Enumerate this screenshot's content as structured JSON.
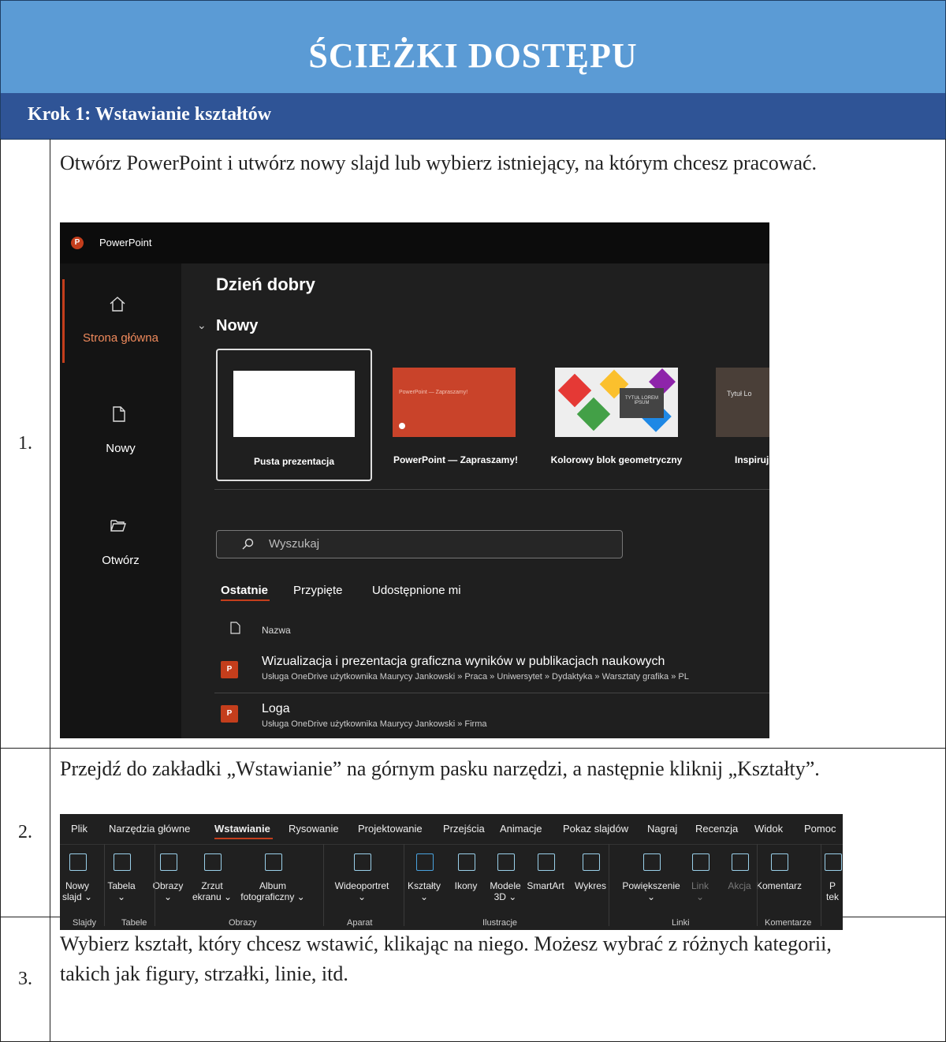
{
  "header": {
    "title": "ŚCIEŻKI DOSTĘPU"
  },
  "step": {
    "title": "Krok 1: Wstawianie kształtów"
  },
  "rows": [
    {
      "num": "1.",
      "text": "Otwórz PowerPoint i utwórz nowy slajd lub wybierz istniejący, na którym chcesz pracować."
    },
    {
      "num": "2.",
      "text": "Przejdź do zakładki „Wstawianie” na górnym pasku narzędzi, a następnie kliknij „Kształty”."
    },
    {
      "num": "3.",
      "text": "Wybierz kształt, który chcesz wstawić, klikając na niego. Możesz wybrać z różnych kategorii, takich jak figury, strzałki, linie, itd."
    }
  ],
  "ppt": {
    "app_name": "PowerPoint",
    "nav": {
      "home": "Strona główna",
      "new": "Nowy",
      "open": "Otwórz"
    },
    "greeting": "Dzień dobry",
    "new_section": "Nowy",
    "templates": [
      {
        "label": "Pusta prezentacja"
      },
      {
        "label": "PowerPoint — Zapraszamy!",
        "thumb_text": "PowerPoint — Zapraszamy!"
      },
      {
        "label": "Kolorowy blok geometryczny",
        "thumb_text": "TYTUŁ LOREM IPSUM"
      },
      {
        "label": "Inspiruj",
        "thumb_text": "Tytuł Lo"
      }
    ],
    "search_placeholder": "Wyszukaj",
    "tabs": [
      "Ostatnie",
      "Przypięte",
      "Udostępnione mi"
    ],
    "column_name": "Nazwa",
    "files": [
      {
        "name": "Wizualizacja i prezentacja graficzna wyników w publikacjach naukowych",
        "path": "Usługa OneDrive użytkownika Maurycy Jankowski » Praca » Uniwersytet » Dydaktyka » Warsztaty grafika » PL"
      },
      {
        "name": "Loga",
        "path": "Usługa OneDrive użytkownika Maurycy Jankowski » Firma"
      }
    ],
    "colors": {
      "accent": "#c43e1c",
      "bg": "#1f1f1f",
      "sidebar": "#141414"
    }
  },
  "ribbon": {
    "tabs": [
      "Plik",
      "Narzędzia główne",
      "Wstawianie",
      "Rysowanie",
      "Projektowanie",
      "Przejścia",
      "Animacje",
      "Pokaz slajdów",
      "Nagraj",
      "Recenzja",
      "Widok",
      "Pomoc"
    ],
    "buttons": [
      {
        "label": "Nowy",
        "sub": "slajd ⌄"
      },
      {
        "label": "Tabela",
        "sub": "⌄"
      },
      {
        "label": "Obrazy",
        "sub": "⌄"
      },
      {
        "label": "Zrzut",
        "sub": "ekranu ⌄"
      },
      {
        "label": "Album",
        "sub": "fotograficzny ⌄"
      },
      {
        "label": "Wideoportret",
        "sub": "⌄"
      },
      {
        "label": "Kształty",
        "sub": "⌄"
      },
      {
        "label": "Ikony",
        "sub": ""
      },
      {
        "label": "Modele",
        "sub": "3D ⌄"
      },
      {
        "label": "SmartArt",
        "sub": ""
      },
      {
        "label": "Wykres",
        "sub": ""
      },
      {
        "label": "Powiększenie",
        "sub": "⌄"
      },
      {
        "label": "Link",
        "sub": "⌄"
      },
      {
        "label": "Akcja",
        "sub": ""
      },
      {
        "label": "Komentarz",
        "sub": ""
      },
      {
        "label": "P",
        "sub": "tek"
      }
    ],
    "groups": [
      "Slajdy",
      "Tabele",
      "Obrazy",
      "Aparat",
      "Ilustracje",
      "Linki",
      "Komentarze"
    ]
  }
}
